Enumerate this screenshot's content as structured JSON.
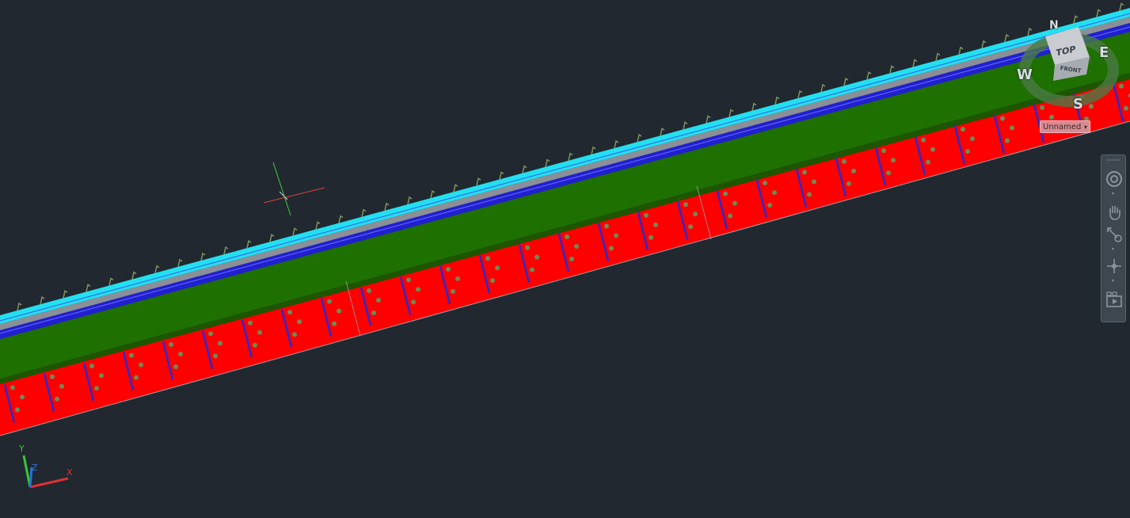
{
  "viewcube": {
    "compass": {
      "north": "N",
      "east": "E",
      "south": "S",
      "west": "W"
    },
    "top_label": "TOP",
    "front_label": "FRONT",
    "ucs_menu_label": "Unnamed",
    "ucs_menu_arrow": "▾"
  },
  "navigation_bar": {
    "tools": [
      {
        "name": "steering-wheel",
        "icon": "steering-wheel-icon"
      },
      {
        "name": "pan",
        "icon": "pan-hand-icon"
      },
      {
        "name": "zoom-extents",
        "icon": "zoom-extents-icon"
      },
      {
        "name": "orbit",
        "icon": "orbit-icon"
      },
      {
        "name": "showmotion",
        "icon": "showmotion-icon"
      }
    ]
  },
  "ucs_icon": {
    "x_label": "X",
    "y_label": "Y",
    "z_label": "Z"
  },
  "colors": {
    "background": "#212830",
    "road_surface": "#1e7000",
    "slope": "#ff0000",
    "edge_cyan": "#22e0f0",
    "edge_blue": "#2020d0",
    "edge_gray": "#8a8f98",
    "markers": "#6e8a55"
  }
}
